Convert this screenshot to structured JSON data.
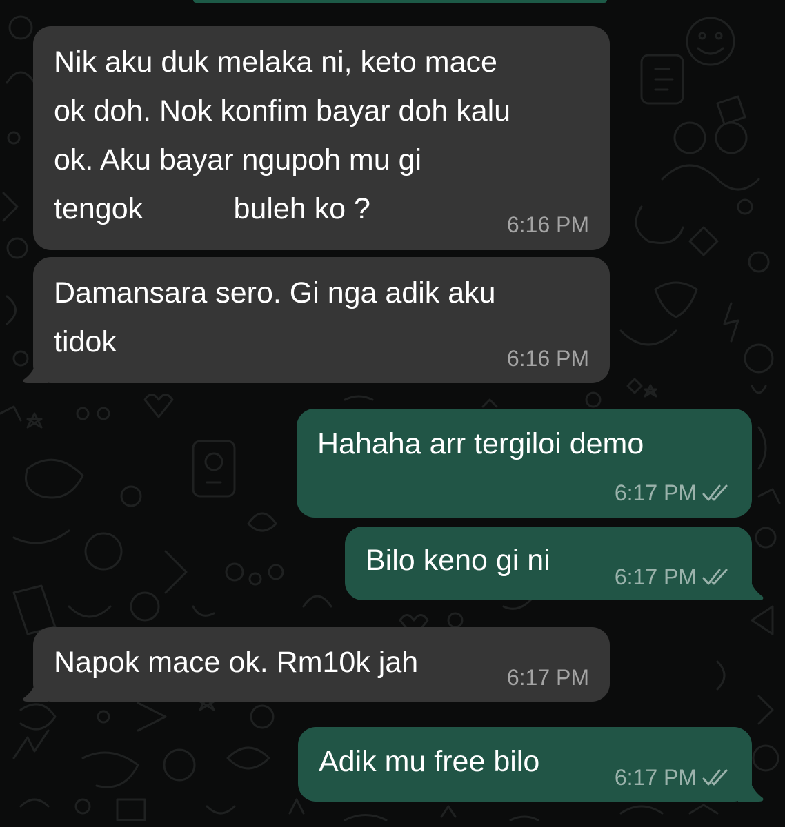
{
  "colors": {
    "background": "#0b0c0c",
    "incoming_bubble": "#363636",
    "outgoing_bubble": "#215546",
    "text": "#ffffff",
    "timestamp": "#9a9a9a"
  },
  "messages": [
    {
      "direction": "incoming",
      "lines": [
        "Nik aku duk melaka ni, keto mace",
        "ok doh. Nok konfim bayar doh kalu",
        "ok. Aku bayar ngupoh mu gi",
        "tengok           buleh ko ?"
      ],
      "time": "6:16 PM"
    },
    {
      "direction": "incoming",
      "lines": [
        "Damansara sero. Gi nga adik aku",
        "tidok"
      ],
      "time": "6:16 PM"
    },
    {
      "direction": "outgoing",
      "lines": [
        "Hahaha arr tergiloi demo"
      ],
      "time": "6:17 PM",
      "status_icon": "double-check-icon"
    },
    {
      "direction": "outgoing",
      "lines": [
        "Bilo keno gi ni"
      ],
      "time": "6:17 PM",
      "status_icon": "double-check-icon"
    },
    {
      "direction": "incoming",
      "lines": [
        "Napok mace ok. Rm10k jah"
      ],
      "time": "6:17 PM"
    },
    {
      "direction": "outgoing",
      "lines": [
        "Adik mu free bilo"
      ],
      "time": "6:17 PM",
      "status_icon": "double-check-icon"
    }
  ]
}
